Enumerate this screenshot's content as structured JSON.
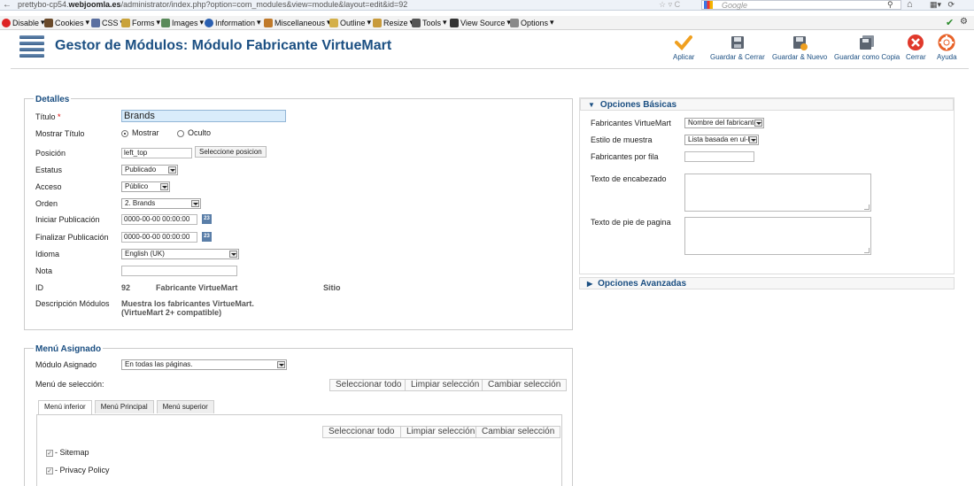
{
  "browser": {
    "url_prefix": "prettybo-cp54.",
    "url_host": "webjoomla.es",
    "url_path": "/administrator/index.php?option=com_modules&view=module&layout=edit&id=92",
    "search_placeholder": "Google"
  },
  "devtoolbar": {
    "items": [
      "Disable",
      "Cookies",
      "CSS",
      "Forms",
      "Images",
      "Information",
      "Miscellaneous",
      "Outline",
      "Resize",
      "Tools",
      "View Source",
      "Options"
    ]
  },
  "header": {
    "title": "Gestor de Módulos: Módulo Fabricante VirtueMart",
    "toolbar": {
      "apply": "Aplicar",
      "save_close": "Guardar & Cerrar",
      "save_new": "Guardar & Nuevo",
      "save_copy": "Guardar como Copia",
      "close": "Cerrar",
      "help": "Ayuda"
    }
  },
  "details": {
    "legend": "Detalles",
    "title_label": "Título",
    "title_value": "Brands",
    "show_title_label": "Mostrar Título",
    "show_option": "Mostrar",
    "hide_option": "Oculto",
    "position_label": "Posición",
    "position_value": "left_top",
    "position_button": "Seleccione posicion",
    "status_label": "Estatus",
    "status_value": "Publicado",
    "access_label": "Acceso",
    "access_value": "Público",
    "order_label": "Orden",
    "order_value": "2. Brands",
    "publish_up_label": "Iniciar Publicación",
    "publish_up_value": "0000-00-00 00:00:00",
    "publish_down_label": "Finalizar Publicación",
    "publish_down_value": "0000-00-00 00:00:00",
    "calendar_day": "23",
    "language_label": "Idioma",
    "language_value": "English (UK)",
    "note_label": "Nota",
    "note_value": "",
    "id_label": "ID",
    "id_value": "92",
    "module_type": "Fabricante VirtueMart",
    "site_label": "Sitio",
    "description_label": "Descripción Módulos",
    "description_line1": "Muestra los fabricantes VirtueMart.",
    "description_line2": "(VirtueMart 2+ compatible)"
  },
  "menu_assignment": {
    "legend": "Menú Asignado",
    "module_assigned_label": "Módulo Asignado",
    "module_assigned_value": "En todas las páginas.",
    "selection_label": "Menú de selección:",
    "select_all": "Seleccionar todo",
    "clear_selection": "Limpiar selección",
    "toggle_selection": "Cambiar selección",
    "tabs": [
      "Menú inferior",
      "Menú Principal",
      "Menú superior"
    ],
    "items": [
      "- Sitemap",
      "- Privacy Policy"
    ]
  },
  "basic_options": {
    "title": "Opciones Básicas",
    "manufacturers_label": "Fabricantes VirtueMart",
    "manufacturers_value": "Nombre del fabricante",
    "style_label": "Estilo de muestra",
    "style_value": "Lista basada en ul-li",
    "per_row_label": "Fabricantes por fila",
    "per_row_value": "",
    "header_text_label": "Texto de encabezado",
    "footer_text_label": "Texto de pie de pagina"
  },
  "advanced_options": {
    "title": "Opciones Avanzadas"
  },
  "colors": {
    "title_blue": "#1b4f82",
    "apply_orange": "#f0a020",
    "close_red": "#e0392b"
  }
}
